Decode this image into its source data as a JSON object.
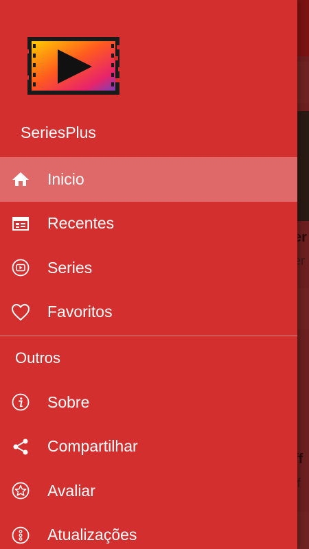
{
  "app": {
    "name": "SeriesPlus"
  },
  "colors": {
    "drawer_bg": "#d32f2f",
    "active_item_bg": "#e06565",
    "text": "#ffffff"
  },
  "background": {
    "card_titles": [
      "er",
      "ff"
    ],
    "card_subtitles": [
      "er",
      "ff"
    ]
  },
  "menu": {
    "main_items": [
      {
        "label": "Inicio",
        "icon": "home-icon",
        "active": true
      },
      {
        "label": "Recentes",
        "icon": "calendar-icon",
        "active": false
      },
      {
        "label": "Series",
        "icon": "play-circle-icon",
        "active": false
      },
      {
        "label": "Favoritos",
        "icon": "heart-icon",
        "active": false
      }
    ],
    "section_title": "Outros",
    "other_items": [
      {
        "label": "Sobre",
        "icon": "info-icon"
      },
      {
        "label": "Compartilhar",
        "icon": "share-icon"
      },
      {
        "label": "Avaliar",
        "icon": "star-icon"
      },
      {
        "label": "Atualizações",
        "icon": "more-dots-icon"
      }
    ]
  }
}
